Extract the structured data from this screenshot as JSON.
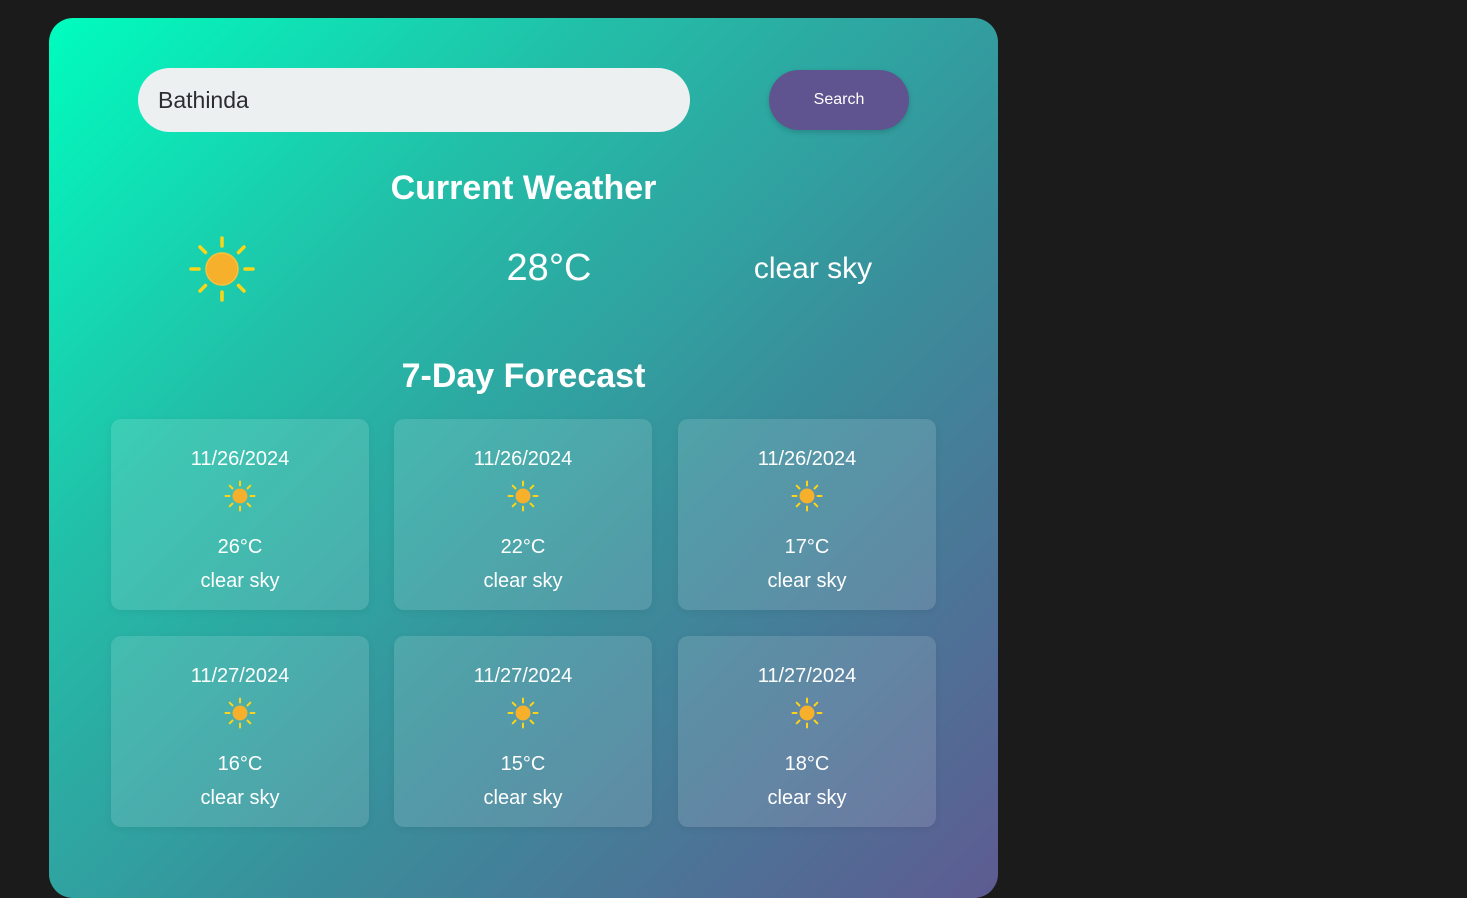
{
  "search": {
    "value": "Bathinda",
    "button_label": "Search"
  },
  "current": {
    "title": "Current Weather",
    "icon": "sun-icon",
    "temperature": "28°C",
    "description": "clear sky"
  },
  "forecast": {
    "title": "7-Day Forecast",
    "items": [
      {
        "date": "11/26/2024",
        "icon": "sun-icon",
        "temperature": "26°C",
        "description": "clear sky"
      },
      {
        "date": "11/26/2024",
        "icon": "sun-icon",
        "temperature": "22°C",
        "description": "clear sky"
      },
      {
        "date": "11/26/2024",
        "icon": "sun-icon",
        "temperature": "17°C",
        "description": "clear sky"
      },
      {
        "date": "11/27/2024",
        "icon": "sun-icon",
        "temperature": "16°C",
        "description": "clear sky"
      },
      {
        "date": "11/27/2024",
        "icon": "sun-icon",
        "temperature": "15°C",
        "description": "clear sky"
      },
      {
        "date": "11/27/2024",
        "icon": "sun-icon",
        "temperature": "18°C",
        "description": "clear sky"
      }
    ]
  },
  "colors": {
    "gradient_start": "#00fdbf",
    "gradient_end": "#5e5b92",
    "button": "#5f548f",
    "sun_core": "#f6b02c",
    "sun_rays": "#fcd418"
  }
}
